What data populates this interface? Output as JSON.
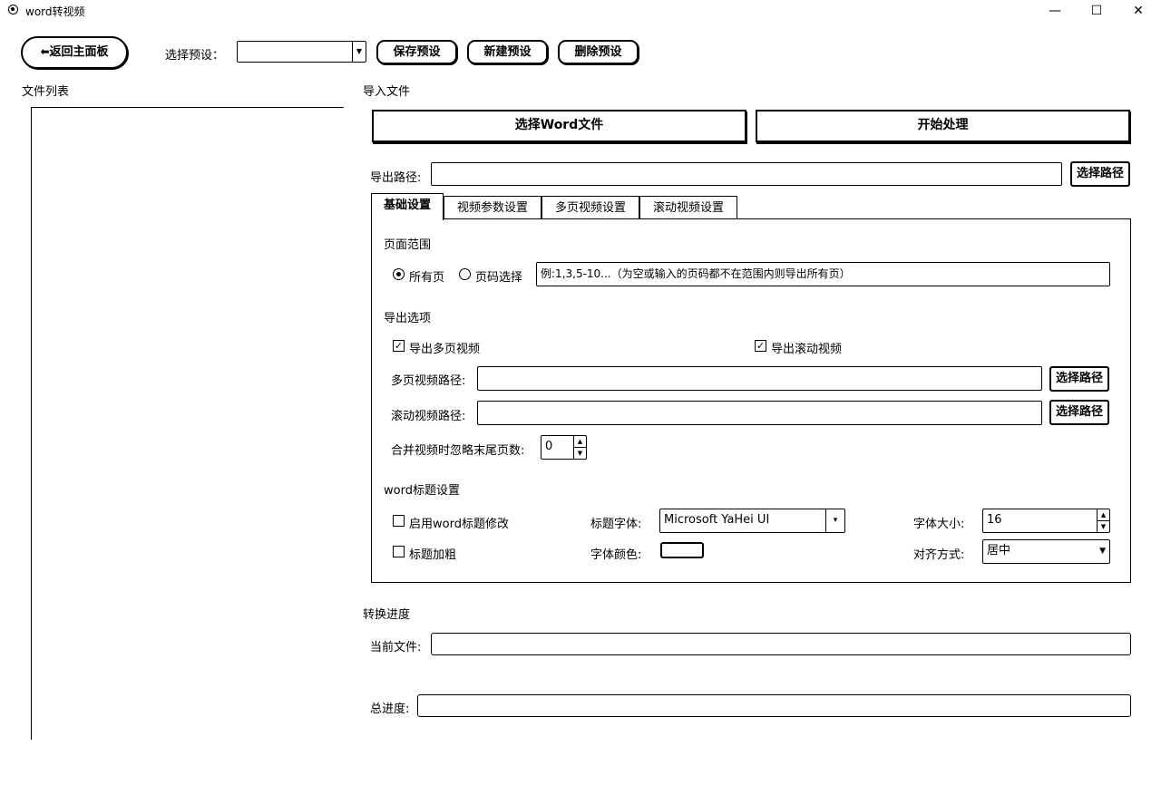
{
  "window": {
    "title": "word转视频",
    "minimize": "—",
    "maximize": "☐",
    "close": "✕"
  },
  "toolbar": {
    "back_label": "返回主面板",
    "back_icon": "arrow-left-icon",
    "preset_label": "选择预设：",
    "preset_value": "",
    "save_preset": "保存预设",
    "new_preset": "新建预设",
    "delete_preset": "删除预设"
  },
  "file_list": {
    "title": "文件列表"
  },
  "import": {
    "title": "导入文件",
    "select_word": "选择Word文件",
    "start": "开始处理",
    "export_label": "导出路径:",
    "export_value": "",
    "choose_path": "选择路径"
  },
  "tabs": [
    {
      "label": "基础设置",
      "active": true
    },
    {
      "label": "视频参数设置",
      "active": false
    },
    {
      "label": "多页视频设置",
      "active": false
    },
    {
      "label": "滚动视频设置",
      "active": false
    }
  ],
  "basic": {
    "page_range_title": "页面范围",
    "all_pages": "所有页",
    "page_select": "页码选择",
    "page_placeholder": "例:1,3,5-10...（为空或输入的页码都不在范围内则导出所有页）",
    "export_options_title": "导出选项",
    "export_multipage": "导出多页视频",
    "export_scroll": "导出滚动视频",
    "multipage_path_label": "多页视频路径:",
    "scroll_path_label": "滚动视频路径:",
    "choose_path": "选择路径",
    "ignore_label": "合并视频时忽略末尾页数:",
    "ignore_value": "0",
    "title_settings": "word标题设置",
    "enable_title": "启用word标题修改",
    "bold_title": "标题加粗",
    "font_label": "标题字体:",
    "font_value": "Microsoft YaHei UI",
    "color_label": "字体颜色:",
    "size_label": "字体大小:",
    "size_value": "16",
    "align_label": "对齐方式:",
    "align_value": "居中"
  },
  "progress": {
    "title": "转换进度",
    "current_label": "当前文件:",
    "total_label": "总进度:"
  }
}
